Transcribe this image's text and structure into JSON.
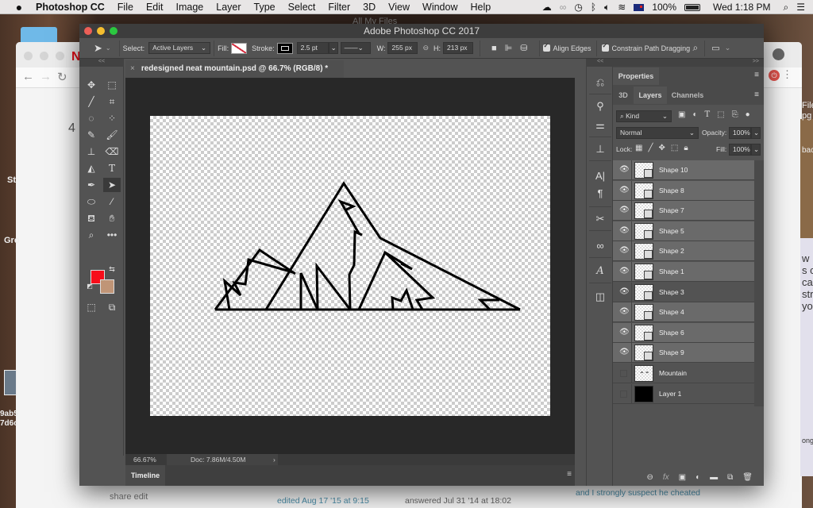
{
  "menubar": {
    "app": "Photoshop CC",
    "items": [
      "File",
      "Edit",
      "Image",
      "Layer",
      "Type",
      "Select",
      "Filter",
      "3D",
      "View",
      "Window",
      "Help"
    ],
    "battery": "100%",
    "clock": "Wed 1:18 PM"
  },
  "background": {
    "finder_title": "All My Files",
    "chrome_number": "4",
    "left_labels": [
      "St",
      "Gro",
      "9ab5",
      "7d6c"
    ],
    "share_edit": "share  edit",
    "edited": "edited Aug 17 '15 at 9:15",
    "answered": "answered Jul 31 '14 at 18:02",
    "comment": "and I strongly suspect he cheated",
    "right_fragments": [
      "File",
      "pg",
      "bac",
      "w",
      "s c",
      "ca",
      "stra",
      "yo",
      "ong"
    ]
  },
  "window": {
    "title": "Adobe Photoshop CC 2017"
  },
  "options": {
    "select_label": "Select:",
    "select_value": "Active Layers",
    "fill_label": "Fill:",
    "stroke_label": "Stroke:",
    "stroke_width": "2.5 pt",
    "w_label": "W:",
    "w_value": "255 px",
    "h_label": "H:",
    "h_value": "213 px",
    "align_edges": "Align Edges",
    "constrain": "Constrain Path Dragging",
    "collapse_left": "<<",
    "collapse_right": ">>"
  },
  "document": {
    "tab_title": "redesigned neat mountain.psd @ 66.7% (RGB/8) *",
    "zoom": "66.67%",
    "doc_size": "Doc: 7.86M/4.50M",
    "status_arrow": "›"
  },
  "timeline": {
    "label": "Timeline"
  },
  "colors": {
    "foreground": "#f70d1a",
    "background": "#c09577"
  },
  "panels": {
    "properties": "Properties",
    "tabs": [
      "3D",
      "Layers",
      "Channels"
    ],
    "active_tab": "Layers",
    "filter_kind": "Kind",
    "blend_mode": "Normal",
    "opacity_label": "Opacity:",
    "opacity": "100%",
    "lock_label": "Lock:",
    "fill_label": "Fill:",
    "fill": "100%"
  },
  "layers": [
    {
      "name": "Shape 10",
      "visible": true,
      "selected": true
    },
    {
      "name": "Shape 8",
      "visible": true,
      "selected": true
    },
    {
      "name": "Shape 7",
      "visible": true,
      "selected": true
    },
    {
      "name": "Shape 5",
      "visible": true,
      "selected": true
    },
    {
      "name": "Shape 2",
      "visible": true,
      "selected": true
    },
    {
      "name": "Shape 1",
      "visible": true,
      "selected": true
    },
    {
      "name": "Shape 3",
      "visible": true,
      "selected": false
    },
    {
      "name": "Shape 4",
      "visible": true,
      "selected": true
    },
    {
      "name": "Shape 6",
      "visible": true,
      "selected": true
    },
    {
      "name": "Shape 9",
      "visible": true,
      "selected": true
    },
    {
      "name": "Mountain",
      "visible": false,
      "selected": false
    },
    {
      "name": "Layer 1",
      "visible": false,
      "selected": false
    }
  ]
}
